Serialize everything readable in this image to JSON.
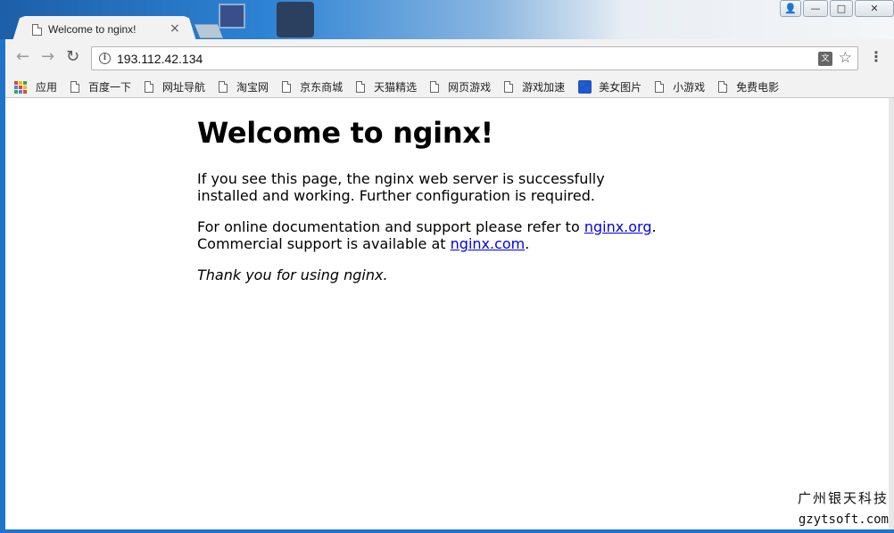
{
  "browser": {
    "tab": {
      "title": "Welcome to nginx!",
      "close": "×"
    },
    "window_controls": {
      "user": "👤",
      "minimize": "—",
      "maximize": "□",
      "close": "✕"
    },
    "toolbar": {
      "back": "←",
      "forward": "→",
      "reload": "↻",
      "menu": "⋮"
    },
    "address": {
      "url": "193.112.42.134",
      "info": "i",
      "translate": "文",
      "star": "☆"
    },
    "bookmarks": [
      {
        "label": "应用",
        "icon": "apps-grid-icon"
      },
      {
        "label": "百度一下",
        "icon": "page-icon"
      },
      {
        "label": "网址导航",
        "icon": "page-icon"
      },
      {
        "label": "淘宝网",
        "icon": "page-icon"
      },
      {
        "label": "京东商城",
        "icon": "page-icon"
      },
      {
        "label": "天猫精选",
        "icon": "page-icon"
      },
      {
        "label": "网页游戏",
        "icon": "page-icon"
      },
      {
        "label": "游戏加速",
        "icon": "page-icon"
      },
      {
        "label": "美女图片",
        "icon": "paw-icon"
      },
      {
        "label": "小游戏",
        "icon": "page-icon"
      },
      {
        "label": "免费电影",
        "icon": "page-icon"
      }
    ],
    "apps_colors": [
      "#e94235",
      "#fbbc05",
      "#34a853",
      "#4285f4",
      "#e94235",
      "#fbbc05",
      "#34a853",
      "#4285f4",
      "#e94235"
    ]
  },
  "page": {
    "heading": "Welcome to nginx!",
    "para1": "If you see this page, the nginx web server is successfully installed and working. Further configuration is required.",
    "para2_prefix": "For online documentation and support please refer to ",
    "link1": "nginx.org",
    "para2_mid": ".",
    "para2_line2": "Commercial support is available at ",
    "link2": "nginx.com",
    "para2_end": ".",
    "thanks": "Thank you for using nginx.",
    "link_color": "#0000ee"
  },
  "watermark": {
    "cn": "广州银天科技",
    "en": "gzytsoft.com"
  }
}
